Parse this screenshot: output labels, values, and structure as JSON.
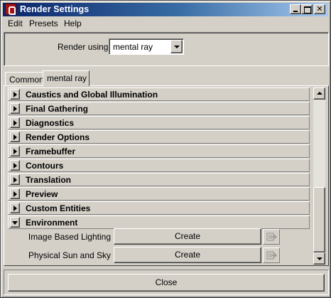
{
  "window": {
    "title": "Render Settings",
    "controls": [
      "minimize",
      "maximize",
      "close"
    ]
  },
  "menu": {
    "items": [
      "Edit",
      "Presets",
      "Help"
    ]
  },
  "render_using": {
    "label": "Render using:",
    "selected": "mental ray"
  },
  "tabs": [
    {
      "label": "Common",
      "active": false
    },
    {
      "label": "mental ray",
      "active": true
    }
  ],
  "sections": [
    {
      "title": "Caustics and Global Illumination",
      "expanded": false
    },
    {
      "title": "Final Gathering",
      "expanded": false
    },
    {
      "title": "Diagnostics",
      "expanded": false
    },
    {
      "title": "Render Options",
      "expanded": false
    },
    {
      "title": "Framebuffer",
      "expanded": false
    },
    {
      "title": "Contours",
      "expanded": false
    },
    {
      "title": "Translation",
      "expanded": false
    },
    {
      "title": "Preview",
      "expanded": false
    },
    {
      "title": "Custom Entities",
      "expanded": false
    },
    {
      "title": "Environment",
      "expanded": true
    }
  ],
  "environment": {
    "rows": [
      {
        "label": "Image Based Lighting",
        "button": "Create",
        "icon": "map-connection-icon"
      },
      {
        "label": "Physical Sun and Sky",
        "button": "Create",
        "icon": "map-connection-icon"
      }
    ]
  },
  "footer": {
    "close_label": "Close"
  },
  "colors": {
    "title_bar_start": "#0a246a",
    "title_bar_end": "#a6caf0",
    "face": "#d4d0c8"
  }
}
